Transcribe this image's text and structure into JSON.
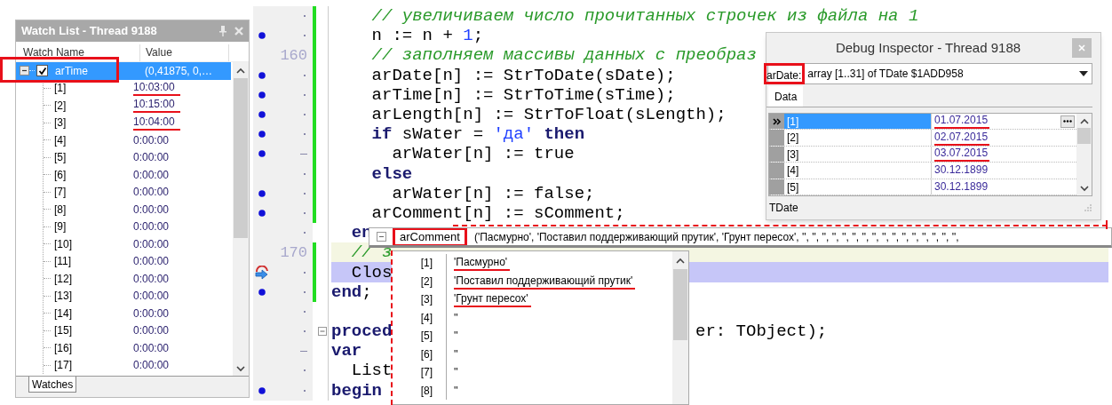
{
  "watch_list": {
    "title": "Watch List - Thread 9188",
    "columns": [
      "Watch Name",
      "Value"
    ],
    "rows": [
      {
        "name": "arTime",
        "value": "(0,41875, 0,…",
        "checked": true,
        "expanded": true,
        "selected": true,
        "annotated": true,
        "children": [
          {
            "name": "[1]",
            "value": "10:03:00",
            "underlined": true,
            "selected": false
          },
          {
            "name": "[2]",
            "value": "10:15:00",
            "underlined": true,
            "selected": false
          },
          {
            "name": "[3]",
            "value": "10:04:00",
            "underlined": true,
            "selected": false
          },
          {
            "name": "[4]",
            "value": "0:00:00",
            "underlined": false,
            "selected": false
          },
          {
            "name": "[5]",
            "value": "0:00:00",
            "underlined": false,
            "selected": false
          },
          {
            "name": "[6]",
            "value": "0:00:00",
            "underlined": false,
            "selected": false
          },
          {
            "name": "[7]",
            "value": "0:00:00",
            "underlined": false,
            "selected": false
          },
          {
            "name": "[8]",
            "value": "0:00:00",
            "underlined": false,
            "selected": false
          },
          {
            "name": "[9]",
            "value": "0:00:00",
            "underlined": false,
            "selected": false
          },
          {
            "name": "[10]",
            "value": "0:00:00",
            "underlined": false,
            "selected": false
          },
          {
            "name": "[11]",
            "value": "0:00:00",
            "underlined": false,
            "selected": false
          },
          {
            "name": "[12]",
            "value": "0:00:00",
            "underlined": false,
            "selected": false
          },
          {
            "name": "[13]",
            "value": "0:00:00",
            "underlined": false,
            "selected": false
          },
          {
            "name": "[14]",
            "value": "0:00:00",
            "underlined": false,
            "selected": false
          },
          {
            "name": "[15]",
            "value": "0:00:00",
            "underlined": false,
            "selected": false
          },
          {
            "name": "[16]",
            "value": "0:00:00",
            "underlined": false,
            "selected": false
          },
          {
            "name": "[17]",
            "value": "0:00:00",
            "underlined": false,
            "selected": false
          }
        ]
      }
    ],
    "tabs": [
      {
        "label": "Watches",
        "selected": true
      }
    ]
  },
  "editor": {
    "lines": [
      {
        "kind": "dot",
        "breakpoint": false,
        "execution_point": false,
        "current": false,
        "modified": true,
        "foldable": false,
        "tokens": [
          {
            "kind": "comment",
            "text": "    // увеличиваем число прочитанных строчек из файла на 1"
          }
        ]
      },
      {
        "kind": "dot",
        "breakpoint": true,
        "execution_point": false,
        "current": false,
        "modified": true,
        "foldable": false,
        "tokens": [
          {
            "kind": "plain",
            "text": "    n := n + "
          },
          {
            "kind": "number",
            "text": "1"
          },
          {
            "kind": "plain",
            "text": ";"
          }
        ]
      },
      {
        "kind": "numbered",
        "number": "160",
        "breakpoint": false,
        "execution_point": false,
        "current": false,
        "modified": true,
        "foldable": false,
        "tokens": [
          {
            "kind": "comment",
            "text": "    // заполняем массивы данных с преобраз"
          }
        ]
      },
      {
        "kind": "dot",
        "breakpoint": true,
        "execution_point": false,
        "current": false,
        "modified": true,
        "foldable": false,
        "tokens": [
          {
            "kind": "plain",
            "text": "    arDate[n] := StrToDate(sDate);"
          }
        ]
      },
      {
        "kind": "dot",
        "breakpoint": true,
        "execution_point": false,
        "current": false,
        "modified": true,
        "foldable": false,
        "tokens": [
          {
            "kind": "plain",
            "text": "    arTime[n] := StrToTime(sTime);"
          }
        ]
      },
      {
        "kind": "dot",
        "breakpoint": true,
        "execution_point": false,
        "current": false,
        "modified": true,
        "foldable": false,
        "tokens": [
          {
            "kind": "plain",
            "text": "    arLength[n] := StrToFloat(sLength);"
          }
        ]
      },
      {
        "kind": "dot",
        "breakpoint": true,
        "execution_point": false,
        "current": false,
        "modified": true,
        "foldable": false,
        "tokens": [
          {
            "kind": "keyword",
            "text": "    if"
          },
          {
            "kind": "plain",
            "text": " sWater = "
          },
          {
            "kind": "string",
            "text": "'да'"
          },
          {
            "kind": "keyword",
            "text": " then"
          }
        ]
      },
      {
        "kind": "dash",
        "breakpoint": true,
        "execution_point": false,
        "current": false,
        "modified": true,
        "foldable": false,
        "tokens": [
          {
            "kind": "plain",
            "text": "      arWater[n] := true"
          }
        ]
      },
      {
        "kind": "dot",
        "breakpoint": false,
        "execution_point": false,
        "current": false,
        "modified": true,
        "foldable": false,
        "tokens": [
          {
            "kind": "keyword",
            "text": "    else"
          }
        ]
      },
      {
        "kind": "dot",
        "breakpoint": true,
        "execution_point": false,
        "current": false,
        "modified": true,
        "foldable": false,
        "tokens": [
          {
            "kind": "plain",
            "text": "      arWater[n] := false;"
          }
        ]
      },
      {
        "kind": "dot",
        "breakpoint": true,
        "execution_point": false,
        "current": false,
        "modified": true,
        "foldable": false,
        "tokens": [
          {
            "kind": "plain",
            "text": "    arComment[n] := sComment;"
          }
        ]
      },
      {
        "kind": "dot",
        "breakpoint": false,
        "execution_point": false,
        "current": false,
        "modified": false,
        "foldable": false,
        "tokens": [
          {
            "kind": "keyword",
            "text": "  en"
          }
        ]
      },
      {
        "kind": "numbered",
        "number": "170",
        "breakpoint": false,
        "execution_point": false,
        "current": true,
        "modified": true,
        "foldable": false,
        "tokens": [
          {
            "kind": "comment",
            "text": "  // з"
          }
        ]
      },
      {
        "kind": "dot",
        "breakpoint": false,
        "execution_point": true,
        "current": false,
        "modified": true,
        "foldable": false,
        "tokens": [
          {
            "kind": "plain",
            "text": "  Clos"
          }
        ]
      },
      {
        "kind": "dot",
        "breakpoint": true,
        "execution_point": false,
        "current": false,
        "modified": true,
        "foldable": false,
        "tokens": [
          {
            "kind": "keyword",
            "text": "end"
          },
          {
            "kind": "plain",
            "text": ";"
          }
        ]
      },
      {
        "kind": "dot",
        "breakpoint": false,
        "execution_point": false,
        "current": false,
        "modified": false,
        "foldable": false
      },
      {
        "kind": "dot",
        "breakpoint": false,
        "execution_point": false,
        "current": false,
        "modified": false,
        "foldable": true,
        "tokens": [
          {
            "kind": "keyword",
            "text": "proced"
          }
        ],
        "tail": "er: TObject);"
      },
      {
        "kind": "dash",
        "breakpoint": false,
        "execution_point": false,
        "current": false,
        "modified": false,
        "foldable": false,
        "tokens": [
          {
            "kind": "keyword",
            "text": "var"
          }
        ]
      },
      {
        "kind": "dot",
        "breakpoint": false,
        "execution_point": false,
        "current": false,
        "modified": false,
        "foldable": false,
        "tokens": [
          {
            "kind": "plain",
            "text": "  List"
          }
        ]
      },
      {
        "kind": "dot",
        "breakpoint": true,
        "execution_point": false,
        "current": false,
        "modified": false,
        "foldable": false,
        "tokens": [
          {
            "kind": "keyword",
            "text": "begin"
          }
        ]
      }
    ]
  },
  "debug_inspector": {
    "title": "Debug Inspector - Thread 9188",
    "expression": {
      "name": "arDate:",
      "annotated": true,
      "type": "array [1..31] of TDate $1ADD958"
    },
    "tabs": [
      {
        "label": "Data",
        "selected": true
      }
    ],
    "rows": [
      {
        "name": "[1]",
        "value": "01.07.2015",
        "selected": true,
        "underlined": true
      },
      {
        "name": "[2]",
        "value": "02.07.2015",
        "selected": false,
        "underlined": true
      },
      {
        "name": "[3]",
        "value": "03.07.2015",
        "selected": false,
        "underlined": true
      },
      {
        "name": "[4]",
        "value": "30.12.1899",
        "selected": false,
        "underlined": false
      },
      {
        "name": "[5]",
        "value": "30.12.1899",
        "selected": false,
        "underlined": false
      }
    ],
    "status": "TDate"
  },
  "evaluation_tooltip": {
    "name": "arComment",
    "annotated": true,
    "expanded": true,
    "value": "('Пасмурно', 'Поставил поддерживающий прутик', 'Грунт пересох', '', '', '', '', '', '', '', '', '', '', '', '', '', '', '', '',",
    "items": [
      {
        "index": "[1]",
        "value": "'Пасмурно'",
        "underlined": true
      },
      {
        "index": "[2]",
        "value": "'Поставил поддерживающий прутик'",
        "underlined": true
      },
      {
        "index": "[3]",
        "value": "'Грунт пересох'",
        "underlined": true
      },
      {
        "index": "[4]",
        "value": "''",
        "underlined": false
      },
      {
        "index": "[5]",
        "value": "''",
        "underlined": false
      },
      {
        "index": "[6]",
        "value": "''",
        "underlined": false
      },
      {
        "index": "[7]",
        "value": "''",
        "underlined": false
      },
      {
        "index": "[8]",
        "value": "''",
        "underlined": false
      }
    ]
  }
}
